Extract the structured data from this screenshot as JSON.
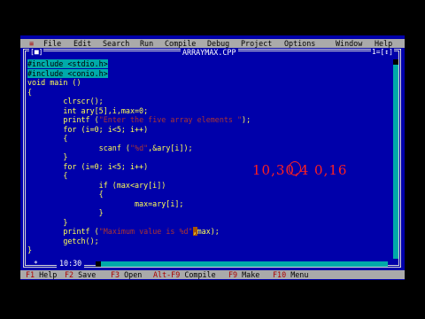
{
  "menu": {
    "system": "≡",
    "items": [
      "File",
      "Edit",
      "Search",
      "Run",
      "Compile",
      "Debug",
      "Project",
      "Options",
      "Window",
      "Help"
    ]
  },
  "window": {
    "close_box": "[■]",
    "title": "ARRAYMAX.CPP",
    "number": "1=[↕]"
  },
  "code": [
    {
      "text": "#include <stdio.h>",
      "kind": "include"
    },
    {
      "text": "#include <conio.h>",
      "kind": "include"
    },
    {
      "text": "void main ()"
    },
    {
      "text": "{"
    },
    {
      "text": "        clrscr();"
    },
    {
      "text": "        int ary[5],i,max=0;"
    },
    {
      "pre": "        printf (",
      "str": "\"Enter the five array elements \"",
      "post": ");"
    },
    {
      "text": "        for (i=0; i<5; i++)"
    },
    {
      "text": "        {"
    },
    {
      "pre": "                scanf (",
      "str": "\"%d\"",
      "post": ",&ary[i]);"
    },
    {
      "text": "        }"
    },
    {
      "text": "        for (i=0; i<5; i++)"
    },
    {
      "text": "        {"
    },
    {
      "text": "                if (max<ary[i])"
    },
    {
      "text": "                {"
    },
    {
      "text": "                        max=ary[i];"
    },
    {
      "text": "                }"
    },
    {
      "text": "        }"
    },
    {
      "pre": "        printf (",
      "str": "\"Maximum value is %d\"",
      "cursor": ",",
      "post": "max);"
    },
    {
      "text": "        getch();"
    },
    {
      "text": "}"
    }
  ],
  "handwriting": "10,30,4 0,16",
  "status": {
    "modified": "*",
    "position": "10:30"
  },
  "function_keys": [
    {
      "key": "F1",
      "label": "Help"
    },
    {
      "key": "F2",
      "label": "Save"
    },
    {
      "key": "F3",
      "label": "Open"
    },
    {
      "key": "Alt-F9",
      "label": "Compile"
    },
    {
      "key": "F9",
      "label": "Make"
    },
    {
      "key": "F10",
      "label": "Menu"
    }
  ],
  "colors": {
    "editor_bg": "#0000aa",
    "code_fg": "#ffff55",
    "menu_bg": "#aaaaaa",
    "hotkey": "#aa0000",
    "annotation": "#ff2020"
  }
}
